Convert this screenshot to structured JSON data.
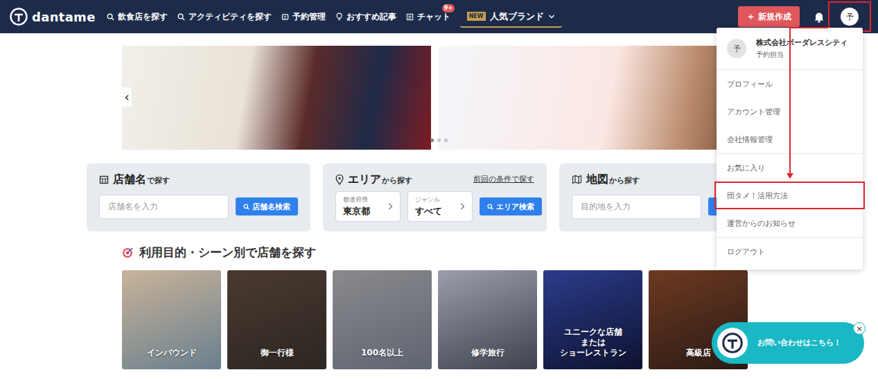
{
  "nav": {
    "logo": "dantame",
    "items": [
      {
        "label": "飲食店を探す",
        "badge": ""
      },
      {
        "label": "アクティビティを探す",
        "badge": ""
      },
      {
        "label": "予約管理",
        "badge": ""
      },
      {
        "label": "おすすめ記事",
        "badge": ""
      },
      {
        "label": "チャット",
        "badge": "9+"
      }
    ],
    "brand": {
      "tag": "NEW",
      "label": "人気ブランド"
    },
    "create_button": {
      "icon": "＋",
      "label": "新規作成"
    },
    "avatar": {
      "initial": "予",
      "highlighted": true
    }
  },
  "user_menu": {
    "open": true,
    "avatar": "予",
    "company": "株式会社ボーダレスシティ",
    "role": "予約担当",
    "groups": [
      [
        {
          "label": "プロフィール",
          "highlighted": false
        },
        {
          "label": "アカウント管理",
          "highlighted": false
        },
        {
          "label": "会社情報管理",
          "highlighted": false
        }
      ],
      [
        {
          "label": "お気に入り",
          "highlighted": false
        },
        {
          "label": "団タメ！活用方法",
          "highlighted": true
        },
        {
          "label": "運営からのお知らせ",
          "highlighted": false
        }
      ],
      [
        {
          "label": "ログアウト",
          "highlighted": false
        }
      ]
    ]
  },
  "carousel": {
    "prev": "‹",
    "dots": [
      {
        "selected": true
      },
      {
        "selected": false
      },
      {
        "selected": false
      }
    ]
  },
  "search": {
    "by_name": {
      "title": "店舗名",
      "suffix": "で探す",
      "placeholder": "店舗名を入力",
      "button": "店舗名検索"
    },
    "by_area": {
      "title": "エリア",
      "suffix": "から探す",
      "link": "前回の条件で探す",
      "selects": [
        {
          "label": "都道府県",
          "value": "東京都"
        },
        {
          "label": "ジャンル",
          "value": "すべて"
        }
      ],
      "button": "エリア検索"
    },
    "by_map": {
      "title": "地図",
      "suffix": "から探す",
      "placeholder": "目的地を入力"
    }
  },
  "scenes": {
    "title": "利用目的・シーン別で店舗を探す",
    "items": [
      "インバウンド",
      "御一行様",
      "100名以上",
      "修学旅行",
      "ユニークな店舗\nまたは\nショーレストラン",
      "高級店"
    ]
  },
  "contact": {
    "label": "お問い合わせはこちら！",
    "close": "×"
  }
}
